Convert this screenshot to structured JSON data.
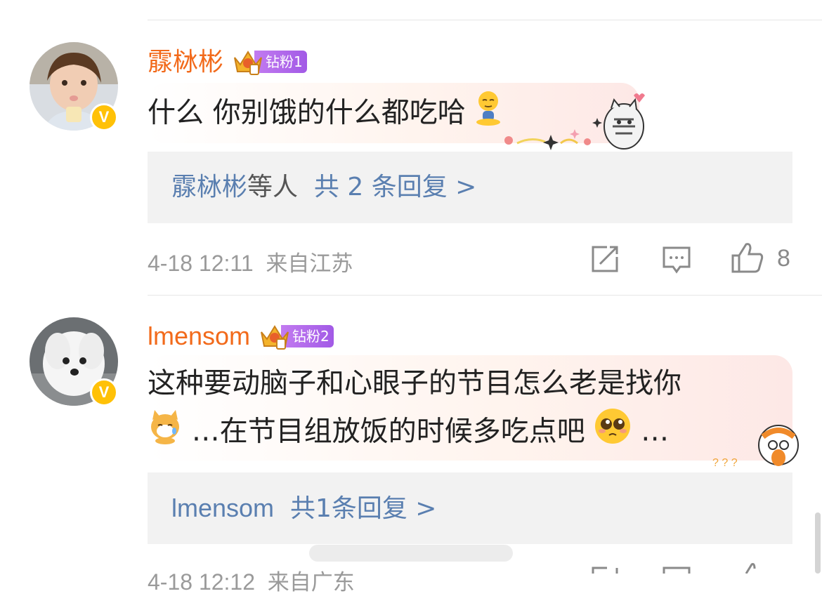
{
  "comments": [
    {
      "username": "霡栤彬",
      "fan_badge": "钻粉1",
      "text": "什么  你别饿的什么都吃哈",
      "reply_author": "霡栤彬",
      "reply_suffix": "等人",
      "reply_count": "共 2 条回复 >",
      "time": "4-18 12:11",
      "location": "来自江苏",
      "likes": "8"
    },
    {
      "username": "lmensom",
      "fan_badge": "钻粉2",
      "text_line1": "这种要动脑子和心眼子的节目怎么老是找你",
      "text_line2": "…在节目组放饭的时候多吃点吧",
      "text_line2_end": "…",
      "reply_author": "lmensom",
      "reply_count": "共1条回复 >",
      "time": "4-18 12:12",
      "location": "来自广东"
    }
  ],
  "colors": {
    "username": "#f26a1b",
    "link": "#5a7fb0",
    "meta": "#9a9a9a",
    "badge": "#ffc107"
  },
  "icons": [
    "repost-icon",
    "comment-icon",
    "like-icon",
    "verified-badge-icon",
    "crown-icon"
  ]
}
